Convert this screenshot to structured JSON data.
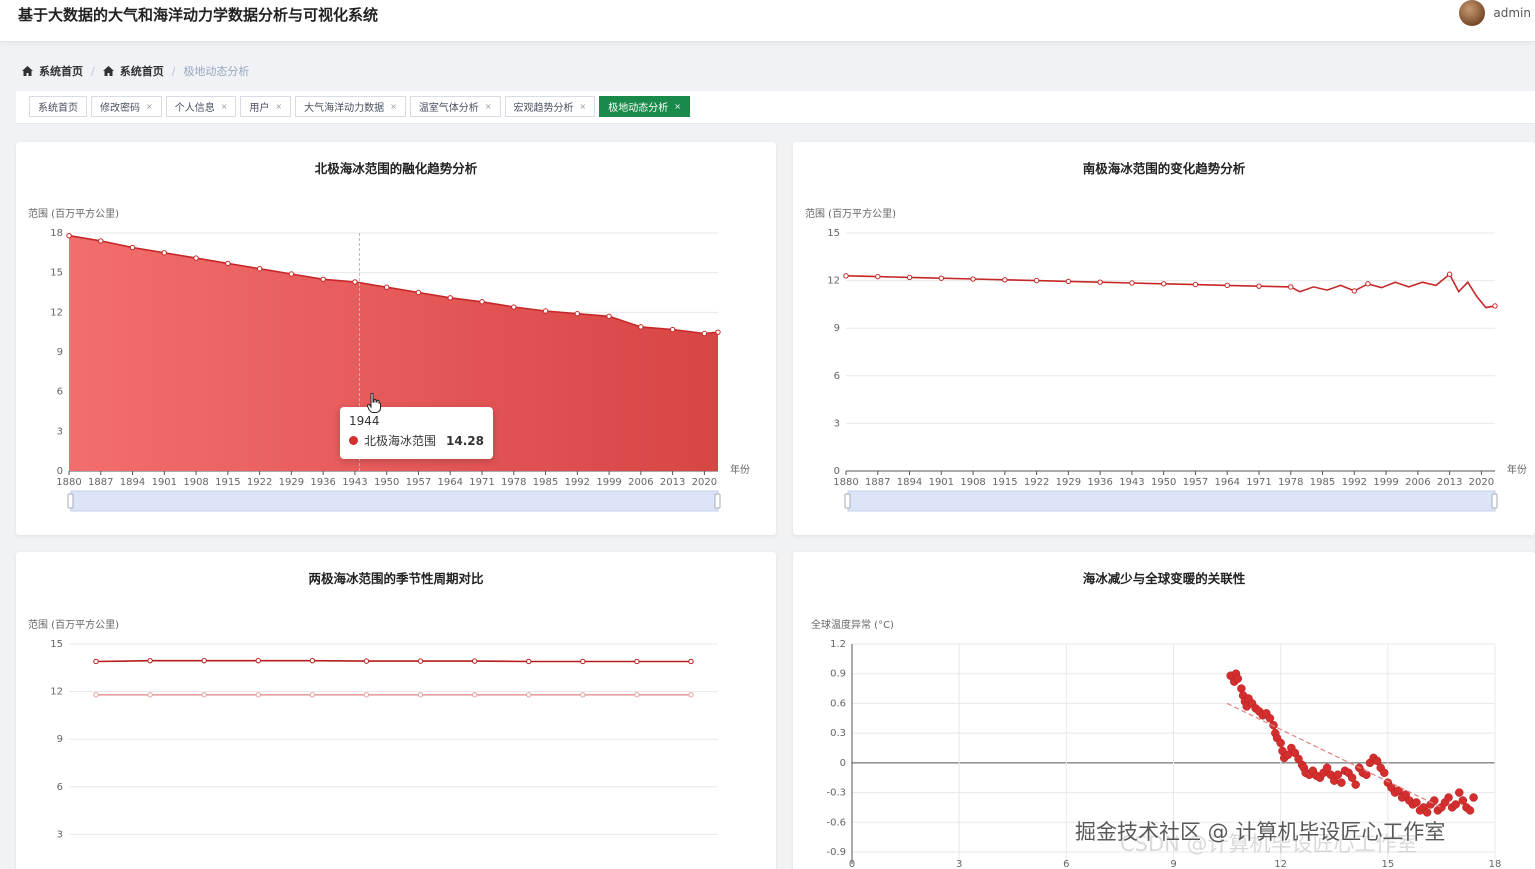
{
  "header": {
    "app_title": "基于大数据的大气和海洋动力学数据分析与可视化系统",
    "user_name": "admin"
  },
  "breadcrumb": [
    "系统首页",
    "系统首页",
    "极地动态分析"
  ],
  "tabs": [
    {
      "label": "系统首页",
      "closable": false,
      "active": false
    },
    {
      "label": "修改密码",
      "closable": true,
      "active": false
    },
    {
      "label": "个人信息",
      "closable": true,
      "active": false
    },
    {
      "label": "用户",
      "closable": true,
      "active": false
    },
    {
      "label": "大气海洋动力数据",
      "closable": true,
      "active": false
    },
    {
      "label": "温室气体分析",
      "closable": true,
      "active": false
    },
    {
      "label": "宏观趋势分析",
      "closable": true,
      "active": false
    },
    {
      "label": "极地动态分析",
      "closable": true,
      "active": true
    }
  ],
  "tab_close_glyph": "×",
  "colors": {
    "accent": "#1a8a4a",
    "series_red": "#d32f2f",
    "series_light": "#e8a0a0"
  },
  "tooltip": {
    "year": "1944",
    "series": "北极海冰范围",
    "value": "14.28"
  },
  "watermark": {
    "line1": "掘金技术社区 @ 计算机毕设匠心工作室",
    "line2": "CSDN @计算机毕设匠心工作室"
  },
  "chart_data": [
    {
      "type": "area",
      "title": "北极海冰范围的融化趋势分析",
      "ylabel": "范围 (百万平方公里)",
      "xlabel": "年份",
      "ylim": [
        0,
        18
      ],
      "yticks": [
        0,
        3,
        6,
        9,
        12,
        15,
        18
      ],
      "xlim": [
        1880,
        2023
      ],
      "xticks": [
        1880,
        1887,
        1894,
        1901,
        1908,
        1915,
        1922,
        1929,
        1936,
        1943,
        1950,
        1957,
        1964,
        1971,
        1978,
        1985,
        1992,
        1999,
        2006,
        2013,
        2020
      ],
      "series": [
        {
          "name": "北极海冰范围",
          "x": [
            1880,
            1887,
            1894,
            1901,
            1908,
            1915,
            1922,
            1929,
            1936,
            1943,
            1950,
            1957,
            1964,
            1971,
            1978,
            1985,
            1992,
            1999,
            2006,
            2013,
            2020,
            2023
          ],
          "values": [
            17.8,
            17.4,
            16.9,
            16.5,
            16.1,
            15.7,
            15.3,
            14.9,
            14.5,
            14.3,
            13.9,
            13.5,
            13.1,
            12.8,
            12.4,
            12.1,
            11.9,
            11.7,
            10.9,
            10.7,
            10.4,
            10.5
          ]
        }
      ],
      "crosshair_x": 1944,
      "has_datazoom": true
    },
    {
      "type": "line",
      "title": "南极海冰范围的变化趋势分析",
      "ylabel": "范围 (百万平方公里)",
      "xlabel": "年份",
      "ylim": [
        0,
        15
      ],
      "yticks": [
        0,
        3,
        6,
        9,
        12,
        15
      ],
      "xlim": [
        1880,
        2023
      ],
      "xticks": [
        1880,
        1887,
        1894,
        1901,
        1908,
        1915,
        1922,
        1929,
        1936,
        1943,
        1950,
        1957,
        1964,
        1971,
        1978,
        1985,
        1992,
        1999,
        2006,
        2013,
        2020
      ],
      "series": [
        {
          "name": "南极海冰范围",
          "x": [
            1880,
            1887,
            1894,
            1901,
            1908,
            1915,
            1922,
            1929,
            1936,
            1943,
            1950,
            1957,
            1964,
            1971,
            1978,
            1980,
            1983,
            1986,
            1989,
            1992,
            1995,
            1998,
            2001,
            2004,
            2007,
            2010,
            2013,
            2015,
            2017,
            2019,
            2021,
            2023
          ],
          "values": [
            12.3,
            12.25,
            12.2,
            12.15,
            12.1,
            12.05,
            12.0,
            11.95,
            11.9,
            11.85,
            11.8,
            11.75,
            11.7,
            11.65,
            11.6,
            11.3,
            11.6,
            11.4,
            11.7,
            11.35,
            11.8,
            11.55,
            11.9,
            11.6,
            11.9,
            11.7,
            12.4,
            11.3,
            11.9,
            11.0,
            10.3,
            10.4
          ]
        }
      ],
      "has_datazoom": true
    },
    {
      "type": "line",
      "title": "两极海冰范围的季节性周期对比",
      "ylabel": "范围 (百万平方公里)",
      "ylim": [
        0,
        15
      ],
      "yticks": [
        3,
        6,
        9,
        12,
        15
      ],
      "series": [
        {
          "name": "北极海冰范围",
          "values": [
            13.9,
            13.95,
            13.95,
            13.95,
            13.95,
            13.92,
            13.92,
            13.92,
            13.9,
            13.9,
            13.9,
            13.9
          ]
        },
        {
          "name": "南极海冰范围",
          "values": [
            11.8,
            11.8,
            11.8,
            11.8,
            11.8,
            11.8,
            11.8,
            11.8,
            11.8,
            11.8,
            11.8,
            11.8
          ]
        }
      ]
    },
    {
      "type": "scatter",
      "title": "海冰减少与全球变暖的关联性",
      "ylabel": "全球温度异常 (°C)",
      "xlim": [
        0,
        18
      ],
      "ylim": [
        -0.9,
        1.2
      ],
      "xticks": [
        0,
        3,
        6,
        9,
        12,
        15,
        18
      ],
      "yticks": [
        "1.2",
        "0.9",
        "0.6",
        "0.3",
        "0",
        "-0.3",
        "-0.6",
        "-0.9"
      ],
      "trendline": {
        "x": [
          10.5,
          16.5
        ],
        "y": [
          0.6,
          -0.45
        ]
      },
      "points": [
        [
          10.6,
          0.88
        ],
        [
          10.7,
          0.82
        ],
        [
          10.75,
          0.9
        ],
        [
          10.8,
          0.85
        ],
        [
          10.9,
          0.75
        ],
        [
          10.95,
          0.68
        ],
        [
          11.0,
          0.62
        ],
        [
          11.05,
          0.57
        ],
        [
          11.1,
          0.65
        ],
        [
          11.2,
          0.6
        ],
        [
          11.3,
          0.55
        ],
        [
          11.4,
          0.52
        ],
        [
          11.5,
          0.48
        ],
        [
          11.6,
          0.5
        ],
        [
          11.7,
          0.45
        ],
        [
          11.8,
          0.38
        ],
        [
          11.85,
          0.3
        ],
        [
          11.9,
          0.25
        ],
        [
          12.0,
          0.2
        ],
        [
          12.05,
          0.12
        ],
        [
          12.1,
          0.05
        ],
        [
          12.2,
          0.08
        ],
        [
          12.3,
          0.15
        ],
        [
          12.4,
          0.1
        ],
        [
          12.5,
          0.04
        ],
        [
          12.6,
          -0.02
        ],
        [
          12.65,
          -0.05
        ],
        [
          12.7,
          -0.1
        ],
        [
          12.8,
          -0.12
        ],
        [
          12.9,
          -0.08
        ],
        [
          13.0,
          -0.13
        ],
        [
          13.1,
          -0.15
        ],
        [
          13.2,
          -0.1
        ],
        [
          13.3,
          -0.05
        ],
        [
          13.4,
          -0.12
        ],
        [
          13.5,
          -0.18
        ],
        [
          13.6,
          -0.12
        ],
        [
          13.7,
          -0.2
        ],
        [
          13.8,
          -0.08
        ],
        [
          13.9,
          -0.1
        ],
        [
          14.0,
          -0.15
        ],
        [
          14.1,
          -0.22
        ],
        [
          14.2,
          -0.05
        ],
        [
          14.3,
          -0.1
        ],
        [
          14.4,
          -0.12
        ],
        [
          14.5,
          0.0
        ],
        [
          14.6,
          0.05
        ],
        [
          14.7,
          0.02
        ],
        [
          14.8,
          -0.05
        ],
        [
          14.9,
          -0.1
        ],
        [
          15.0,
          -0.2
        ],
        [
          15.1,
          -0.25
        ],
        [
          15.2,
          -0.3
        ],
        [
          15.3,
          -0.28
        ],
        [
          15.4,
          -0.35
        ],
        [
          15.5,
          -0.32
        ],
        [
          15.6,
          -0.38
        ],
        [
          15.7,
          -0.42
        ],
        [
          15.8,
          -0.4
        ],
        [
          15.9,
          -0.48
        ],
        [
          16.0,
          -0.45
        ],
        [
          16.1,
          -0.5
        ],
        [
          16.2,
          -0.42
        ],
        [
          16.3,
          -0.38
        ],
        [
          16.4,
          -0.48
        ],
        [
          16.5,
          -0.45
        ],
        [
          16.6,
          -0.4
        ],
        [
          16.7,
          -0.35
        ],
        [
          16.8,
          -0.45
        ],
        [
          16.9,
          -0.42
        ],
        [
          17.0,
          -0.3
        ],
        [
          17.1,
          -0.38
        ],
        [
          17.2,
          -0.45
        ],
        [
          17.3,
          -0.48
        ],
        [
          17.4,
          -0.35
        ]
      ]
    }
  ]
}
